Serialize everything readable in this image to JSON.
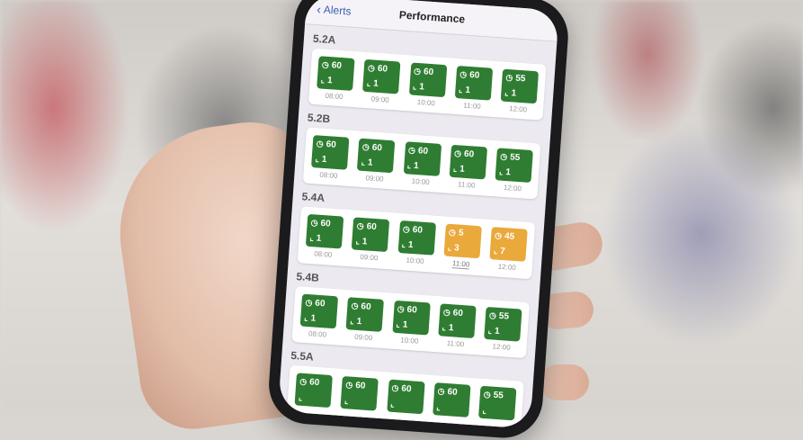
{
  "nav": {
    "back_label": "Alerts",
    "title": "Performance"
  },
  "icons": {
    "clock": "clock-icon",
    "chart": "chart-icon",
    "back": "chevron-left-icon"
  },
  "colors": {
    "good": "#2f7d32",
    "warning": "#e9a93b"
  },
  "sections": [
    {
      "label": "5.2A",
      "slots": [
        {
          "time": "08:00",
          "duration": "60",
          "count": "1",
          "status": "green"
        },
        {
          "time": "09:00",
          "duration": "60",
          "count": "1",
          "status": "green"
        },
        {
          "time": "10:00",
          "duration": "60",
          "count": "1",
          "status": "green"
        },
        {
          "time": "11:00",
          "duration": "60",
          "count": "1",
          "status": "green"
        },
        {
          "time": "12:00",
          "duration": "55",
          "count": "1",
          "status": "green"
        }
      ]
    },
    {
      "label": "5.2B",
      "slots": [
        {
          "time": "08:00",
          "duration": "60",
          "count": "1",
          "status": "green"
        },
        {
          "time": "09:00",
          "duration": "60",
          "count": "1",
          "status": "green"
        },
        {
          "time": "10:00",
          "duration": "60",
          "count": "1",
          "status": "green"
        },
        {
          "time": "11:00",
          "duration": "60",
          "count": "1",
          "status": "green"
        },
        {
          "time": "12:00",
          "duration": "55",
          "count": "1",
          "status": "green"
        }
      ]
    },
    {
      "label": "5.4A",
      "slots": [
        {
          "time": "08:00",
          "duration": "60",
          "count": "1",
          "status": "green"
        },
        {
          "time": "09:00",
          "duration": "60",
          "count": "1",
          "status": "green"
        },
        {
          "time": "10:00",
          "duration": "60",
          "count": "1",
          "status": "green"
        },
        {
          "time": "11:00",
          "duration": "5",
          "count": "3",
          "status": "amber"
        },
        {
          "time": "12:00",
          "duration": "45",
          "count": "7",
          "status": "amber"
        }
      ]
    },
    {
      "label": "5.4B",
      "slots": [
        {
          "time": "08:00",
          "duration": "60",
          "count": "1",
          "status": "green"
        },
        {
          "time": "09:00",
          "duration": "60",
          "count": "1",
          "status": "green"
        },
        {
          "time": "10:00",
          "duration": "60",
          "count": "1",
          "status": "green"
        },
        {
          "time": "11:00",
          "duration": "60",
          "count": "1",
          "status": "green"
        },
        {
          "time": "12:00",
          "duration": "55",
          "count": "1",
          "status": "green"
        }
      ]
    },
    {
      "label": "5.5A",
      "slots": [
        {
          "time": "",
          "duration": "60",
          "count": "",
          "status": "green"
        },
        {
          "time": "",
          "duration": "60",
          "count": "",
          "status": "green"
        },
        {
          "time": "",
          "duration": "60",
          "count": "",
          "status": "green"
        },
        {
          "time": "",
          "duration": "60",
          "count": "",
          "status": "green"
        },
        {
          "time": "",
          "duration": "55",
          "count": "",
          "status": "green"
        }
      ]
    }
  ]
}
